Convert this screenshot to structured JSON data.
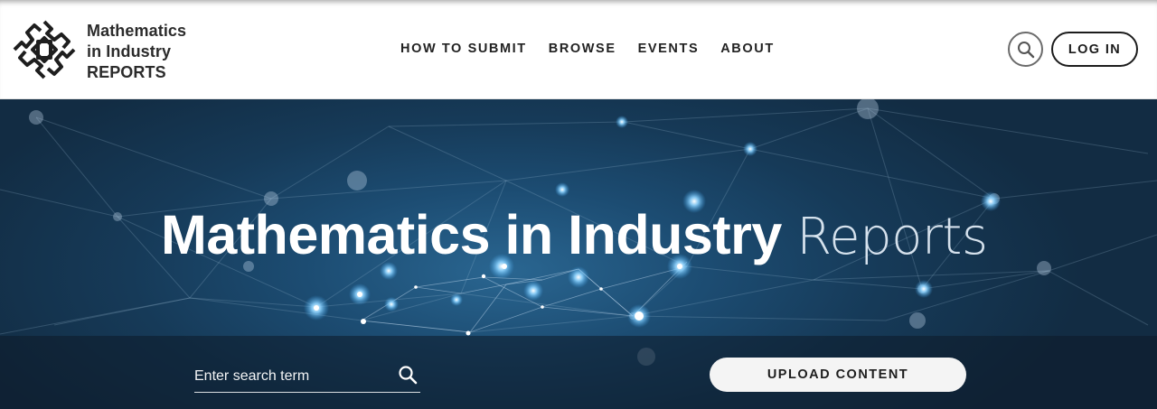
{
  "brand": {
    "line1": "Mathematics",
    "line2": "in Industry",
    "line3": "REPORTS"
  },
  "nav": {
    "items": [
      {
        "label": "HOW TO SUBMIT"
      },
      {
        "label": "BROWSE"
      },
      {
        "label": "EVENTS"
      },
      {
        "label": "ABOUT"
      }
    ]
  },
  "header": {
    "search_icon": "search-icon",
    "login_label": "LOG IN"
  },
  "hero": {
    "title_main": "Mathematics in Industry",
    "title_light": "Reports",
    "search_placeholder": "Enter search term",
    "upload_label": "UPLOAD CONTENT"
  },
  "colors": {
    "hero_dark": "#122c43",
    "hero_mid": "#1c4c72",
    "glow": "#6fc6ff",
    "text_dark": "#1b1b1b"
  }
}
